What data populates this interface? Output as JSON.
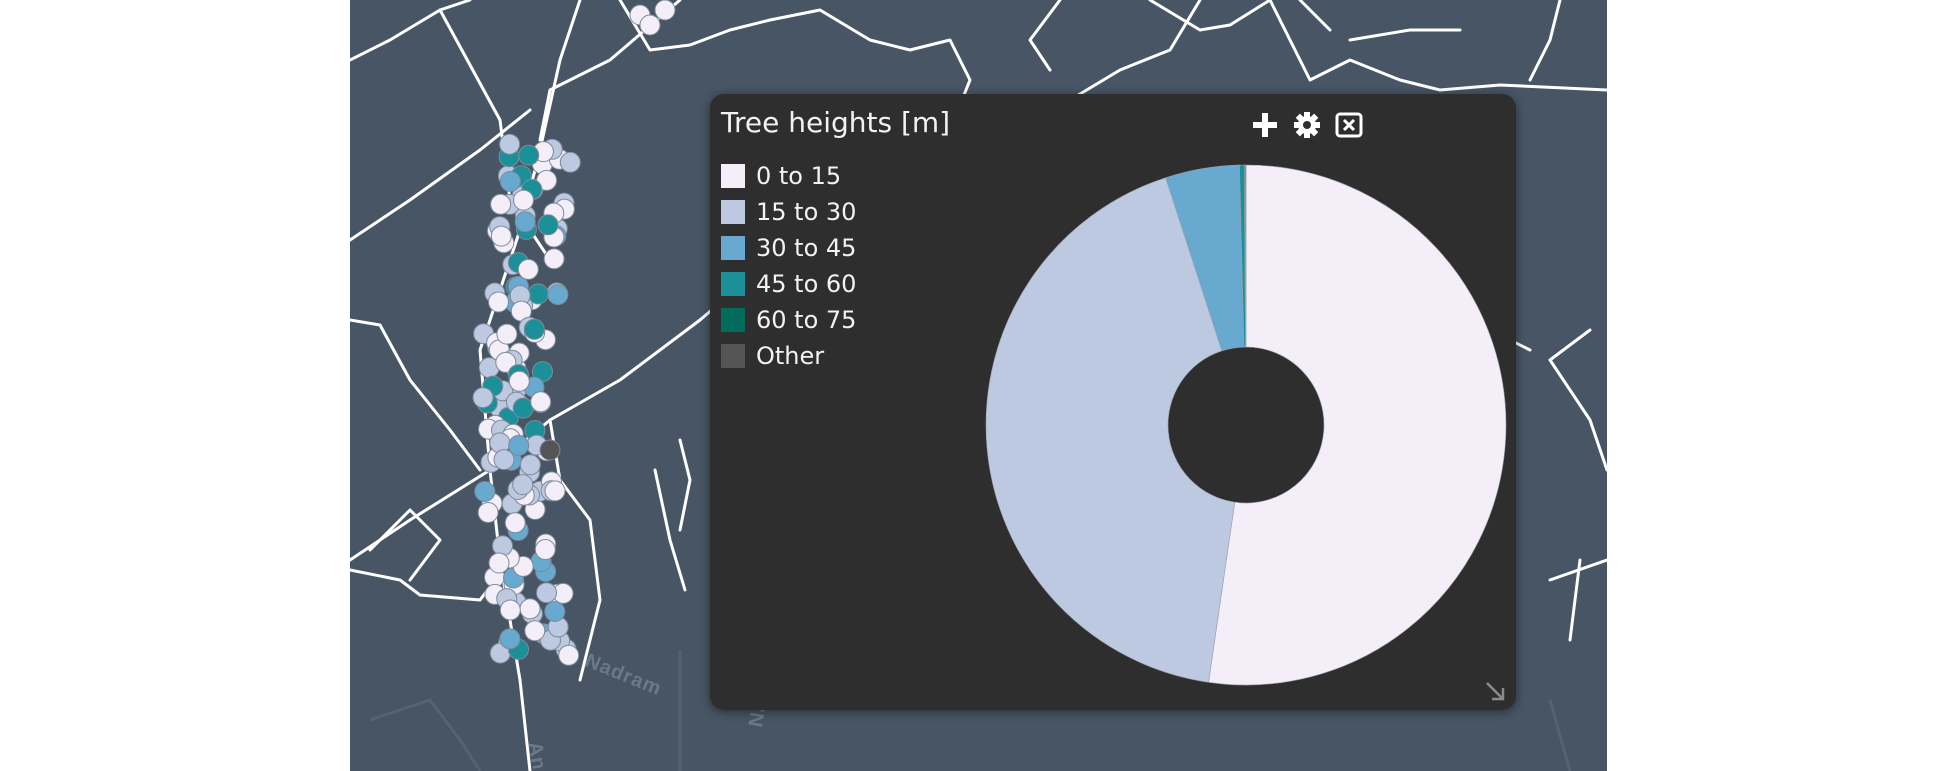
{
  "map": {
    "labels": [
      "Nadram",
      "Nadram",
      "Ang"
    ]
  },
  "panel": {
    "title": "Tree heights [m]",
    "buttons": {
      "add_icon": "plus-icon",
      "settings_icon": "gear-icon",
      "close_icon": "close-box-icon"
    },
    "resize_icon": "resize-corner-icon"
  },
  "chart_data": {
    "type": "pie",
    "title": "Tree heights [m]",
    "donut": true,
    "categories": [
      "0 to 15",
      "15 to 30",
      "30 to 45",
      "45 to 60",
      "60 to 75",
      "Other"
    ],
    "values": [
      52.3,
      42.7,
      4.6,
      0.3,
      0.05,
      0.05
    ],
    "colors": [
      "#f3eef7",
      "#bdc8e1",
      "#67a9cf",
      "#1c9099",
      "#016c59",
      "#555555"
    ],
    "legend_position": "top-left"
  }
}
